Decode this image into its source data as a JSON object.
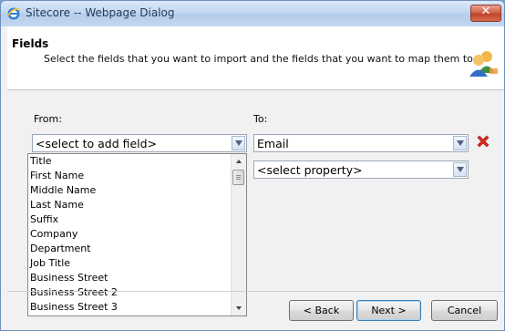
{
  "window": {
    "title": "Sitecore -- Webpage Dialog",
    "close_glyph": "✕"
  },
  "header": {
    "title": "Fields",
    "description": "Select the fields that you want to import and the fields that you want to map them to.",
    "icon": "users-icon"
  },
  "mapping": {
    "from_label": "From:",
    "to_label": "To:",
    "from_select_value": "<select to add field>",
    "to_field_value": "Email",
    "property_select_value": "<select property>",
    "field_list": [
      "Title",
      "First Name",
      "Middle Name",
      "Last Name",
      "Suffix",
      "Company",
      "Department",
      "Job Title",
      "Business Street",
      "Business Street 2",
      "Business Street 3"
    ]
  },
  "buttons": {
    "back": "< Back",
    "next": "Next >",
    "cancel": "Cancel"
  },
  "colors": {
    "titlebar": "#c3d7f1",
    "close_button": "#c0442a",
    "remove_icon": "#d8281c",
    "dialog_bg": "#f1f1f1"
  }
}
